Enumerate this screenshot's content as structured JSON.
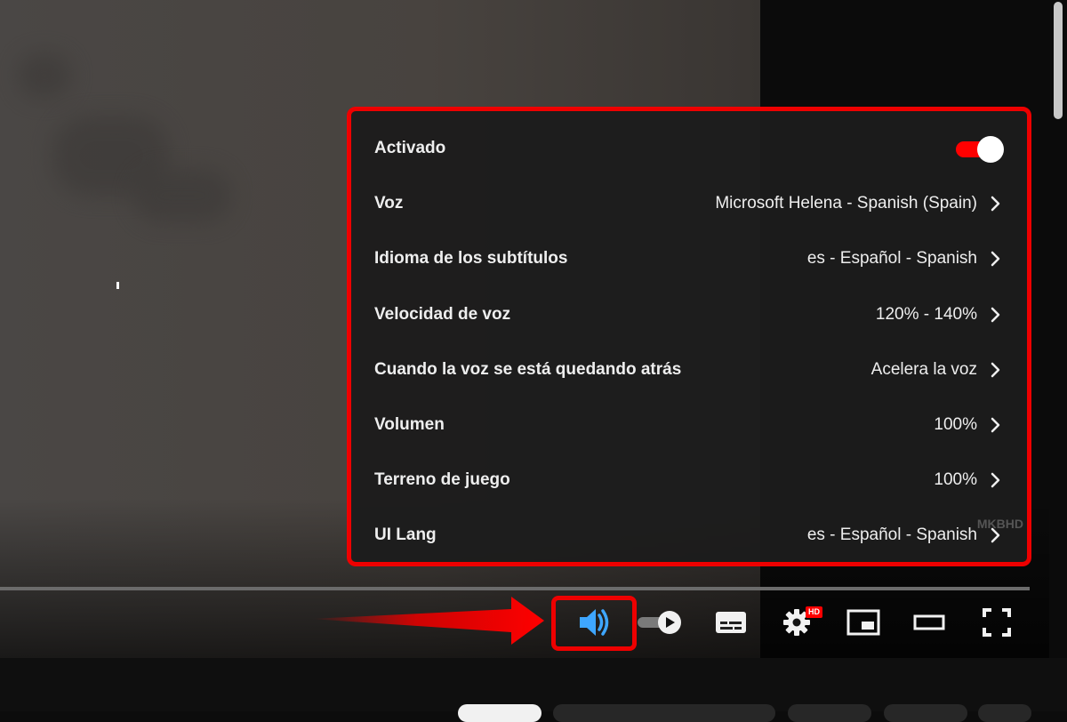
{
  "settings_panel": {
    "enabled_label": "Activado",
    "enabled": true,
    "rows": [
      {
        "label": "Voz",
        "value": "Microsoft Helena - Spanish (Spain)"
      },
      {
        "label": "Idioma de los subtítulos",
        "value": "es - Español - Spanish"
      },
      {
        "label": "Velocidad de voz",
        "value": "120% - 140%"
      },
      {
        "label": "Cuando la voz se está quedando atrás",
        "value": "Acelera la voz"
      },
      {
        "label": "Volumen",
        "value": "100%"
      },
      {
        "label": "Terreno de juego",
        "value": "100%"
      },
      {
        "label": "UI Lang",
        "value": "es - Español - Spanish"
      }
    ],
    "watermark": "MKBHD"
  },
  "player_controls": {
    "icons": [
      "voice-translate-icon",
      "autoplay-toggle-icon",
      "subtitles-icon",
      "settings-gear-icon",
      "miniplayer-icon",
      "theater-mode-icon",
      "fullscreen-icon"
    ],
    "hd_badge": "HD"
  },
  "colors": {
    "accent": "#ff0000",
    "highlight_border": "#ee0000",
    "active_icon": "#3ea6ff"
  }
}
